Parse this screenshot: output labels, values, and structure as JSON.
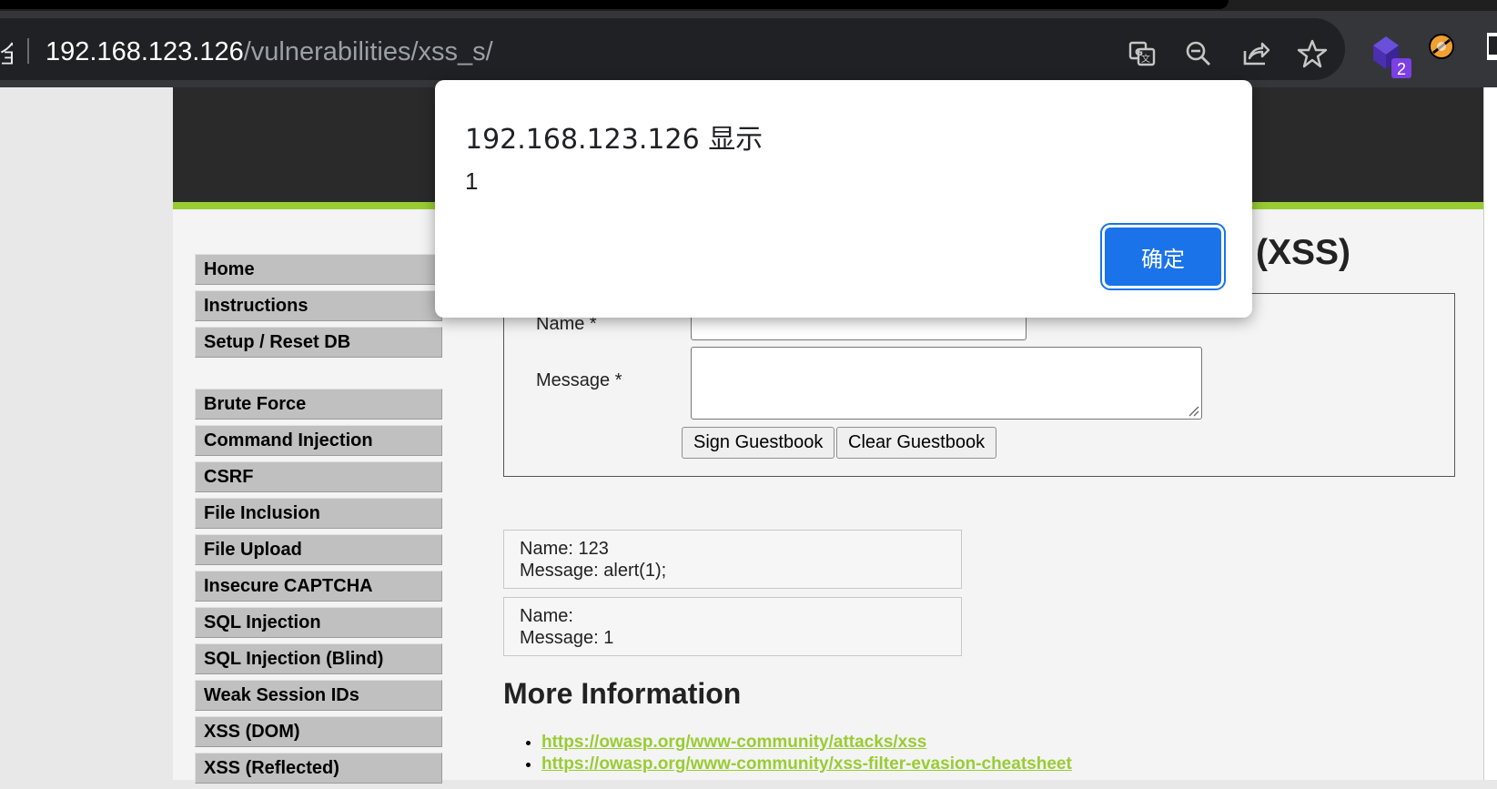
{
  "browser": {
    "lock_fragment": "全",
    "url_host": "192.168.123.126",
    "url_path": "/vulnerabilities/xss_s/",
    "toolbar_icons": [
      "translate-icon",
      "zoom-out-icon",
      "share-icon",
      "bookmark-star-icon"
    ],
    "extension_badge": "2"
  },
  "menu": {
    "group1": [
      "Home",
      "Instructions",
      "Setup / Reset DB"
    ],
    "group2": [
      "Brute Force",
      "Command Injection",
      "CSRF",
      "File Inclusion",
      "File Upload",
      "Insecure CAPTCHA",
      "SQL Injection",
      "SQL Injection (Blind)",
      "Weak Session IDs",
      "XSS (DOM)",
      "XSS (Reflected)"
    ]
  },
  "main": {
    "title_fragment": "(XSS)",
    "form": {
      "name_label": "Name *",
      "message_label": "Message *",
      "name_value": "",
      "message_value": "",
      "sign_button": "Sign Guestbook",
      "clear_button": "Clear Guestbook"
    },
    "entries": [
      {
        "name": "Name: 123",
        "message": "Message: alert(1);"
      },
      {
        "name": "Name:",
        "message": "Message: 1"
      }
    ],
    "more_info_title": "More Information",
    "links": [
      "https://owasp.org/www-community/attacks/xss",
      "https://owasp.org/www-community/xss-filter-evasion-cheatsheet"
    ]
  },
  "dialog": {
    "title": "192.168.123.126 显示",
    "message": "1",
    "ok_button": "确定"
  },
  "colors": {
    "accent_green": "#99cc33",
    "dialog_button": "#1a73e8",
    "header_dark": "#2a2a2a"
  }
}
